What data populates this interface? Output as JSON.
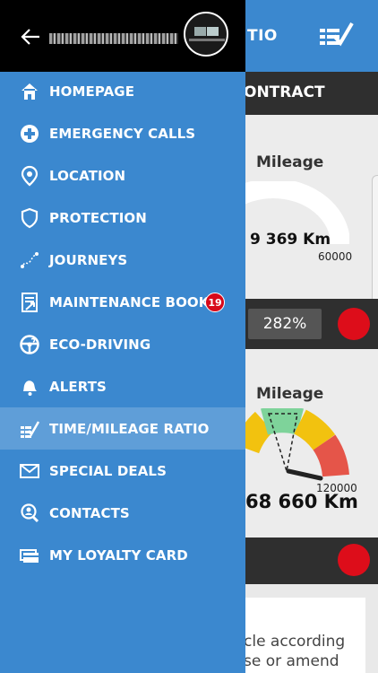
{
  "header": {
    "title_fragment": "TIO"
  },
  "contract": {
    "label_fragment": "ONTRACT"
  },
  "card1": {
    "label": "Mileage",
    "value": "9 369 Km",
    "max": "60000",
    "progress": 0.16
  },
  "ratio": {
    "value": "282%"
  },
  "card2": {
    "label": "Mileage",
    "value": "68 660 Km",
    "max": "120000"
  },
  "bottom_text": {
    "line1": "cle according",
    "line2": "se or amend"
  },
  "status_colors": {
    "alert": "#dd0d1a",
    "accent": "#3b88cf"
  },
  "drawer": {
    "menu": [
      {
        "label": "HOMEPAGE",
        "icon": "home-icon"
      },
      {
        "label": "EMERGENCY CALLS",
        "icon": "emergency-call-icon"
      },
      {
        "label": "LOCATION",
        "icon": "location-pin-icon"
      },
      {
        "label": "PROTECTION",
        "icon": "shield-icon"
      },
      {
        "label": "JOURNEYS",
        "icon": "route-icon"
      },
      {
        "label": "MAINTENANCE BOOK",
        "icon": "maintenance-book-icon",
        "badge": "19"
      },
      {
        "label": "ECO-DRIVING",
        "icon": "steering-wheel-icon"
      },
      {
        "label": "ALERTS",
        "icon": "bell-icon"
      },
      {
        "label": "TIME/MILEAGE RATIO",
        "icon": "ratio-check-icon",
        "active": true
      },
      {
        "label": "SPECIAL DEALS",
        "icon": "envelope-icon"
      },
      {
        "label": "CONTACTS",
        "icon": "contacts-icon"
      },
      {
        "label": "MY LOYALTY CARD",
        "icon": "loyalty-card-icon"
      }
    ]
  }
}
